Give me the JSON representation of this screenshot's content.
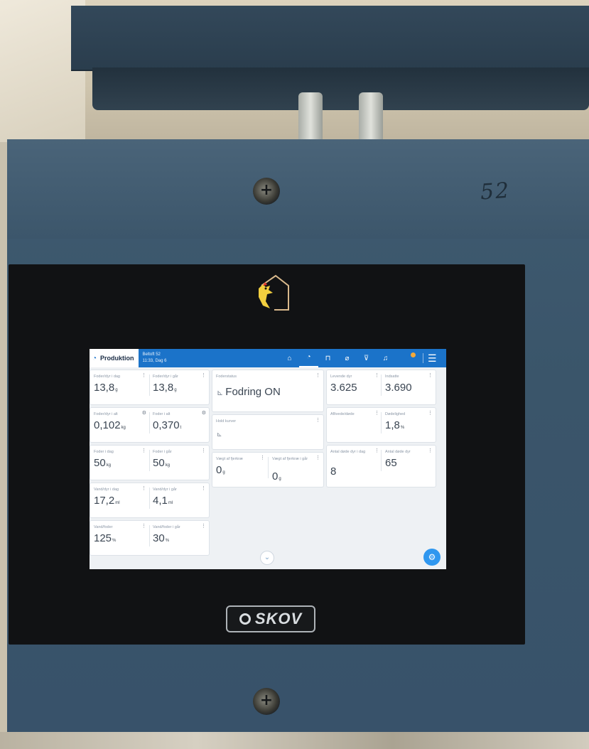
{
  "enclosure": {
    "handwritten_number": "52",
    "brand": "SKOV"
  },
  "topbar": {
    "section_label": "Produktion",
    "site_name": "Beltoft 52",
    "time_day": "11:33, Dag 6"
  },
  "tiles": {
    "foder_dyr_dag": {
      "label": "Foder/dyr i dag",
      "value": "13,8",
      "unit": "g"
    },
    "foder_dyr_gaar": {
      "label": "Foder/dyr i går",
      "value": "13,8",
      "unit": "g"
    },
    "foder_dyr_alt": {
      "label": "Foder/dyr i alt",
      "value": "0,102",
      "unit": "kg"
    },
    "foder_alt": {
      "label": "Foder i alt",
      "value": "0,370",
      "unit": "t"
    },
    "foder_dag": {
      "label": "Foder i dag",
      "value": "50",
      "unit": "kg"
    },
    "foder_gaar": {
      "label": "Foder i går",
      "value": "50",
      "unit": "kg"
    },
    "vand_dyr_dag": {
      "label": "Vand/dyr i dag",
      "value": "17,2",
      "unit": "ml"
    },
    "vand_dyr_gaar": {
      "label": "Vand/dyr i går",
      "value": "4,1",
      "unit": "ml"
    },
    "vand_foder": {
      "label": "Vand/foder",
      "value": "125",
      "unit": "%"
    },
    "vand_foder_gaar": {
      "label": "Vand/foder i går",
      "value": "30",
      "unit": "%"
    },
    "foderstatus": {
      "label": "Foderstatus",
      "value": "Fodring ON"
    },
    "hold_kurver": {
      "label": "Hold kurver"
    },
    "vaegt": {
      "label": "Vægt af fjerkræ",
      "value": "0",
      "unit": "g"
    },
    "vaegt_gaar": {
      "label": "Vægt af fjerkræ i går",
      "value": "0",
      "unit": "g"
    },
    "levende": {
      "label": "Levende dyr",
      "value": "3.625"
    },
    "indsatte": {
      "label": "Indsatte",
      "value": "3.690"
    },
    "aflivede": {
      "label": "Aflivede/døde"
    },
    "dodelighed": {
      "label": "Dødelighed",
      "value": "1,8",
      "unit": "%"
    },
    "doede_dag": {
      "label": "Antal døde dyr i dag",
      "value": "8"
    },
    "doede_dyr": {
      "label": "Antal døde dyr",
      "value": "65"
    }
  },
  "colors": {
    "accent": "#1b73c9",
    "fab": "#2f97ef",
    "badge": "#f3a93a"
  },
  "icons": {
    "nav": [
      "house-icon",
      "gauge-icon",
      "climate-icon",
      "thermometer-icon",
      "feed-icon",
      "bell-icon",
      "menu-icon"
    ],
    "fab": "gear-icon",
    "more": "chevron-down-icon"
  }
}
